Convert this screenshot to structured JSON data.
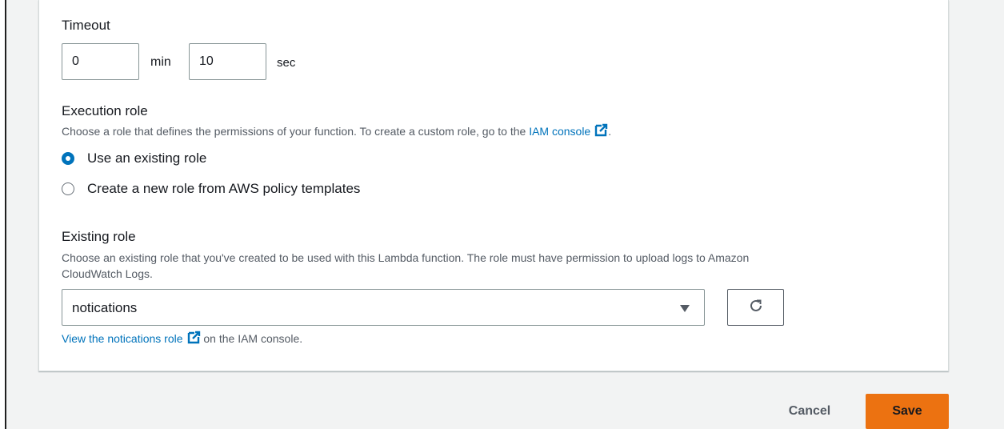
{
  "timeout": {
    "label": "Timeout",
    "minutes_value": "0",
    "minutes_unit": "min",
    "seconds_value": "10",
    "seconds_unit": "sec"
  },
  "execution_role": {
    "label": "Execution role",
    "description_prefix": "Choose a role that defines the permissions of your function. To create a custom role, go to the ",
    "iam_link": "IAM console",
    "description_suffix": ".",
    "options": [
      {
        "label": "Use an existing role",
        "selected": true
      },
      {
        "label": "Create a new role from AWS policy templates",
        "selected": false
      }
    ]
  },
  "existing_role": {
    "label": "Existing role",
    "description_line1": "Choose an existing role that you've created to be used with this Lambda function. The role must have permission to upload logs to Amazon",
    "description_line2": "CloudWatch Logs.",
    "selected_value": "notications",
    "view_link": "View the notications role",
    "view_suffix": " on the IAM console."
  },
  "footer": {
    "cancel_label": "Cancel",
    "save_label": "Save"
  },
  "colors": {
    "link": "#0073bb",
    "primary": "#ec7211",
    "radio_selected": "#0073bb"
  },
  "icons": [
    "external-link-icon",
    "refresh-icon",
    "caret-down-icon"
  ]
}
